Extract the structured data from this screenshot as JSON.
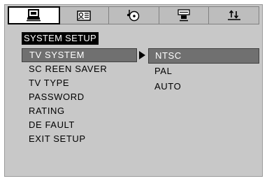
{
  "tabs": [
    {
      "icon": "monitor-icon",
      "active": true
    },
    {
      "icon": "speaker-settings-icon",
      "active": false
    },
    {
      "icon": "audio-disc-icon",
      "active": false
    },
    {
      "icon": "video-settings-icon",
      "active": false
    },
    {
      "icon": "preferences-icon",
      "active": false
    }
  ],
  "section_title": "SYSTEM SETUP",
  "menu": {
    "items": [
      {
        "label": "TV SYSTEM",
        "selected": true
      },
      {
        "label": "SC REEN SAVER",
        "selected": false
      },
      {
        "label": "TV TYPE",
        "selected": false
      },
      {
        "label": "PASSWORD",
        "selected": false
      },
      {
        "label": "RATING",
        "selected": false
      },
      {
        "label": "DE FAULT",
        "selected": false
      },
      {
        "label": "EXIT SETUP",
        "selected": false
      }
    ]
  },
  "submenu": {
    "options": [
      {
        "label": "NTSC",
        "selected": true
      },
      {
        "label": "PAL",
        "selected": false
      },
      {
        "label": "AUTO",
        "selected": false
      }
    ]
  },
  "colors": {
    "background": "#c8c8c8",
    "highlight": "#707070",
    "title_bg": "#000000",
    "text": "#000000"
  }
}
